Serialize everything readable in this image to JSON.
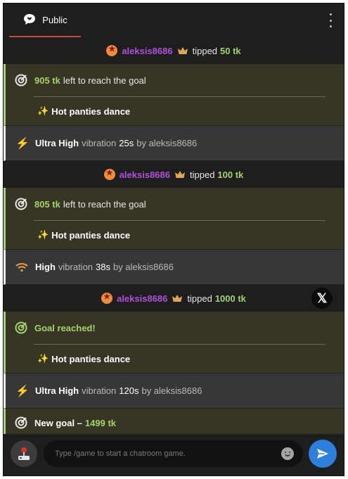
{
  "header": {
    "tab_label": "Public"
  },
  "feed": {
    "tips": [
      {
        "user": "aleksis8686",
        "word": "tipped",
        "amount": "50 tk"
      },
      {
        "user": "aleksis8686",
        "word": "tipped",
        "amount": "100 tk"
      },
      {
        "user": "aleksis8686",
        "word": "tipped",
        "amount": "1000 tk"
      }
    ],
    "goals": [
      {
        "tk": "905 tk",
        "text": "left to reach the goal",
        "item": "Hot panties dance"
      },
      {
        "tk": "805 tk",
        "text": "left to reach the goal",
        "item": "Hot panties dance"
      },
      {
        "reached": "Goal reached!",
        "item": "Hot panties dance"
      }
    ],
    "vibrations": [
      {
        "level": "Ultra High",
        "word": "vibration",
        "duration": "25s",
        "by": "by aleksis8686",
        "icon": "bolt-icon"
      },
      {
        "level": "High",
        "word": "vibration",
        "duration": "38s",
        "by": "by aleksis8686",
        "icon": "wifi-icon"
      },
      {
        "level": "Ultra High",
        "word": "vibration",
        "duration": "120s",
        "by": "by aleksis8686",
        "icon": "bolt-icon"
      }
    ],
    "new_goal": {
      "label": "New goal –",
      "amount": "1499 tk"
    }
  },
  "footer": {
    "placeholder": "Type /game to start a chatroom game."
  },
  "colors": {
    "accent": "#a3d36a",
    "username": "#b14fd8",
    "send": "#2d7fdc",
    "tab_underline": "#c7463e"
  }
}
